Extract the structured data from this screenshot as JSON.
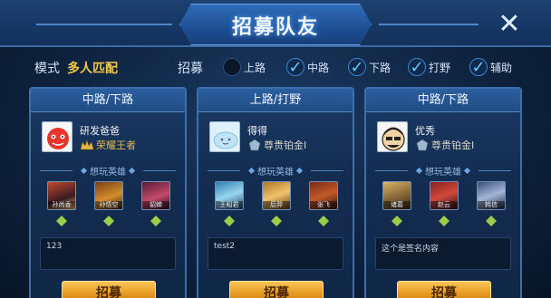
{
  "dialog": {
    "title": "招募队友",
    "close_icon": "close-icon"
  },
  "filters": {
    "mode_label": "模式",
    "mode_value": "多人匹配",
    "recruit_label": "招募",
    "options": [
      {
        "label": "上路",
        "checked": false
      },
      {
        "label": "中路",
        "checked": true
      },
      {
        "label": "下路",
        "checked": true
      },
      {
        "label": "打野",
        "checked": true
      },
      {
        "label": "辅助",
        "checked": true
      }
    ]
  },
  "want_heroes_label": "想玩英雄",
  "colors": {
    "accent_gold": "#f3c64a",
    "check_blue": "#6ec7ff",
    "button_orange": "#e79b22"
  },
  "cards": [
    {
      "role": "中路/下路",
      "player_name": "研发爸爸",
      "rank": "荣耀王者",
      "rank_style": "gold",
      "heroes": [
        "孙尚香",
        "孙悟空",
        "貂蝉"
      ],
      "note": "123",
      "button": "招募"
    },
    {
      "role": "上路/打野",
      "player_name": "得得",
      "rank": "尊贵铂金I",
      "rank_style": "platinum",
      "heroes": [
        "王昭君",
        "后羿",
        "张飞"
      ],
      "note": "test2",
      "button": "招募"
    },
    {
      "role": "中路/下路",
      "player_name": "优秀",
      "rank": "尊贵铂金I",
      "rank_style": "platinum",
      "heroes": [
        "诸葛",
        "赵云",
        "韩信"
      ],
      "note": "这个是签名内容",
      "button": "招募"
    }
  ]
}
